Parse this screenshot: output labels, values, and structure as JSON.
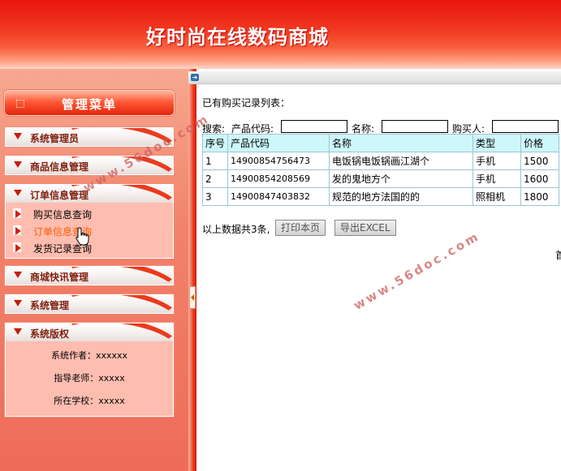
{
  "header": {
    "title": "好时尚在线数码商城"
  },
  "sidebar": {
    "menu_title": "管理菜单",
    "groups": [
      {
        "label": "系统管理员"
      },
      {
        "label": "商品信息管理"
      },
      {
        "label": "订单信息管理",
        "items": [
          {
            "label": "购买信息查询"
          },
          {
            "label": "订单信息查询",
            "active": true
          },
          {
            "label": "发货记录查询"
          }
        ]
      },
      {
        "label": "商城快讯管理"
      },
      {
        "label": "系统管理"
      },
      {
        "label": "系统版权",
        "credits": [
          "系统作者：xxxxxx",
          "指导老师：xxxxx",
          "所在学校：xxxxx"
        ]
      }
    ]
  },
  "content": {
    "list_title": "已有购买记录列表：",
    "search": {
      "label": "搜索:",
      "code_label": "产品代码:",
      "name_label": "名称:",
      "buyer_label": "购买人:",
      "code_value": "",
      "name_value": "",
      "buyer_value": ""
    },
    "table": {
      "headers": [
        "序号",
        "产品代码",
        "名称",
        "类型",
        "价格"
      ],
      "rows": [
        [
          "1",
          "14900854756473",
          "电饭锅电饭锅画江湖个",
          "手机",
          "1500"
        ],
        [
          "2",
          "14900854208569",
          "发的鬼地方个",
          "手机",
          "1600"
        ],
        [
          "3",
          "14900847403832",
          "规范的地方法国的的",
          "照相机",
          "1800"
        ]
      ]
    },
    "summary": "以上数据共3条,",
    "print_button": "打印本页",
    "export_button": "导出EXCEL",
    "edge_text": "首"
  },
  "watermark": "www.56doc.com"
}
